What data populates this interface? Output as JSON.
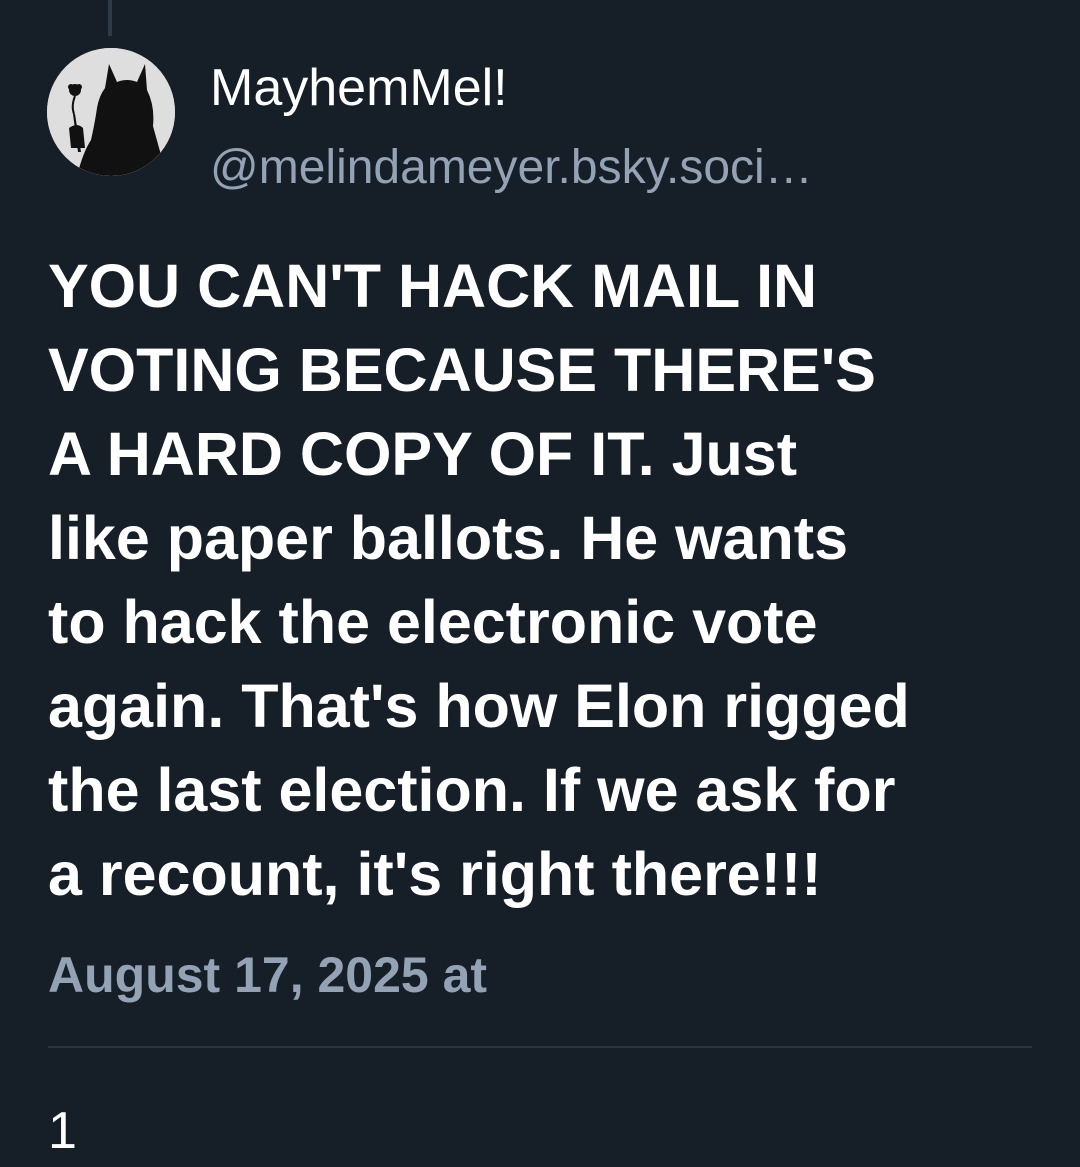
{
  "author": {
    "display_name": "MayhemMel!",
    "handle": "@melindameyer.bsky.soci…",
    "avatar_icon": "silhouette-avatar"
  },
  "post": {
    "text": "YOU CAN'T HACK MAIL IN\nVOTING BECAUSE THERE'S\nA HARD COPY OF IT. Just\nlike paper ballots. He wants\nto hack the electronic vote\nagain. That's how Elon rigged\nthe last election. If we ask for\na recount, it's right there!!!",
    "timestamp": "August 17, 2025 at"
  },
  "stats": {
    "count": "1"
  },
  "colors": {
    "background": "#161e27",
    "text_primary": "#ffffff",
    "text_secondary": "#93a3b5",
    "divider": "#2a3542"
  }
}
